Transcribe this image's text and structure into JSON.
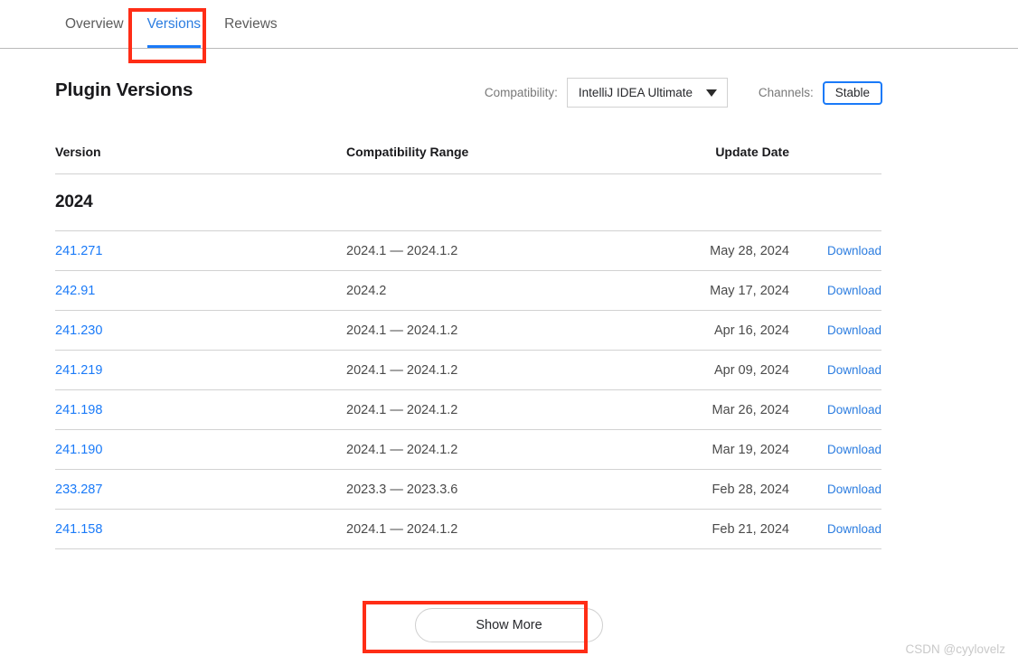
{
  "tabs": [
    {
      "label": "Overview",
      "active": false
    },
    {
      "label": "Versions",
      "active": true
    },
    {
      "label": "Reviews",
      "active": false
    }
  ],
  "page": {
    "title": "Plugin Versions"
  },
  "filters": {
    "compatibility_label": "Compatibility:",
    "compatibility_value": "IntelliJ IDEA Ultimate",
    "caret_icon": "chevron-down-icon",
    "channels_label": "Channels:",
    "channels_value": "Stable"
  },
  "table": {
    "headers": {
      "version": "Version",
      "range": "Compatibility Range",
      "date": "Update Date"
    },
    "group_label": "2024",
    "rows": [
      {
        "version": "241.271",
        "range": "2024.1 — 2024.1.2",
        "date": "May 28, 2024",
        "action": "Download"
      },
      {
        "version": "242.91",
        "range": "2024.2",
        "date": "May 17, 2024",
        "action": "Download"
      },
      {
        "version": "241.230",
        "range": "2024.1 — 2024.1.2",
        "date": "Apr 16, 2024",
        "action": "Download"
      },
      {
        "version": "241.219",
        "range": "2024.1 — 2024.1.2",
        "date": "Apr 09, 2024",
        "action": "Download"
      },
      {
        "version": "241.198",
        "range": "2024.1 — 2024.1.2",
        "date": "Mar 26, 2024",
        "action": "Download"
      },
      {
        "version": "241.190",
        "range": "2024.1 — 2024.1.2",
        "date": "Mar 19, 2024",
        "action": "Download"
      },
      {
        "version": "233.287",
        "range": "2023.3 — 2023.3.6",
        "date": "Feb 28, 2024",
        "action": "Download"
      },
      {
        "version": "241.158",
        "range": "2024.1 — 2024.1.2",
        "date": "Feb 21, 2024",
        "action": "Download"
      }
    ]
  },
  "show_more": {
    "label": "Show More"
  },
  "watermark": {
    "text": "CSDN @cyylovelz"
  },
  "colors": {
    "link": "#1a7af8",
    "accent": "#2c7de0",
    "annotation": "#ff2d16",
    "text": "#27282c",
    "muted": "#787878",
    "border": "#d2d2d2"
  }
}
